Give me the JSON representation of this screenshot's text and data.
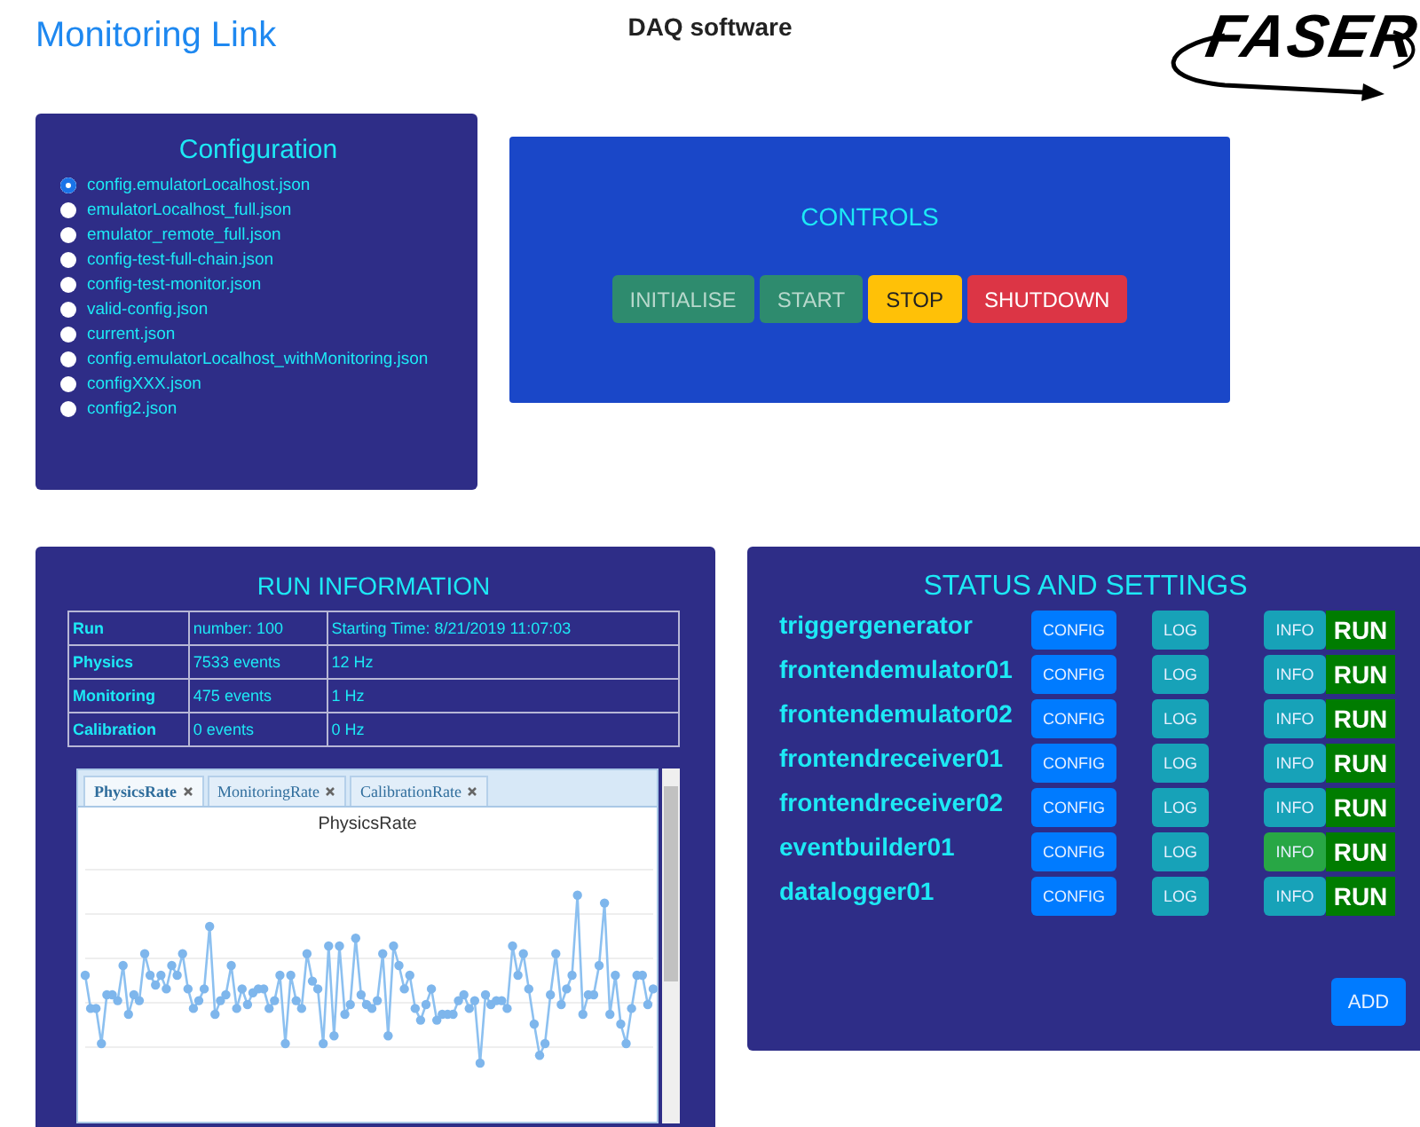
{
  "header": {
    "link": "Monitoring Link",
    "title": "DAQ software",
    "logo": "FASER"
  },
  "configuration": {
    "title": "Configuration",
    "files": [
      {
        "label": "config.emulatorLocalhost.json",
        "selected": true
      },
      {
        "label": "emulatorLocalhost_full.json",
        "selected": false
      },
      {
        "label": "emulator_remote_full.json",
        "selected": false
      },
      {
        "label": "config-test-full-chain.json",
        "selected": false
      },
      {
        "label": "config-test-monitor.json",
        "selected": false
      },
      {
        "label": "valid-config.json",
        "selected": false
      },
      {
        "label": "current.json",
        "selected": false
      },
      {
        "label": "config.emulatorLocalhost_withMonitoring.json",
        "selected": false
      },
      {
        "label": "configXXX.json",
        "selected": false
      },
      {
        "label": "config2.json",
        "selected": false
      }
    ]
  },
  "controls": {
    "title": "CONTROLS",
    "buttons": [
      {
        "label": "INITIALISE",
        "kind": "success",
        "disabled": true
      },
      {
        "label": "START",
        "kind": "success",
        "disabled": true
      },
      {
        "label": "STOP",
        "kind": "warning",
        "disabled": false
      },
      {
        "label": "SHUTDOWN",
        "kind": "danger",
        "disabled": false
      }
    ]
  },
  "run_information": {
    "title": "RUN INFORMATION",
    "rows": [
      [
        "Run",
        "number: 100",
        "Starting Time: 8/21/2019 11:07:03"
      ],
      [
        "Physics",
        "7533 events",
        "12 Hz"
      ],
      [
        "Monitoring",
        "475 events",
        "1 Hz"
      ],
      [
        "Calibration",
        "0 events",
        "0 Hz"
      ]
    ],
    "chart_tabs": [
      {
        "label": "PhysicsRate",
        "selected": true
      },
      {
        "label": "MonitoringRate",
        "selected": false
      },
      {
        "label": "CalibrationRate",
        "selected": false
      }
    ],
    "chart_title": "PhysicsRate"
  },
  "status": {
    "title": "STATUS AND SETTINGS",
    "components": [
      {
        "name": "triggergenerator",
        "config": "CONFIG",
        "log": "LOG",
        "info": "INFO",
        "info_active": false,
        "state": "RUN"
      },
      {
        "name": "frontendemulator01",
        "config": "CONFIG",
        "log": "LOG",
        "info": "INFO",
        "info_active": false,
        "state": "RUN"
      },
      {
        "name": "frontendemulator02",
        "config": "CONFIG",
        "log": "LOG",
        "info": "INFO",
        "info_active": false,
        "state": "RUN"
      },
      {
        "name": "frontendreceiver01",
        "config": "CONFIG",
        "log": "LOG",
        "info": "INFO",
        "info_active": false,
        "state": "RUN"
      },
      {
        "name": "frontendreceiver02",
        "config": "CONFIG",
        "log": "LOG",
        "info": "INFO",
        "info_active": false,
        "state": "RUN"
      },
      {
        "name": "eventbuilder01",
        "config": "CONFIG",
        "log": "LOG",
        "info": "INFO",
        "info_active": true,
        "state": "RUN"
      },
      {
        "name": "datalogger01",
        "config": "CONFIG",
        "log": "LOG",
        "info": "INFO",
        "info_active": false,
        "state": "RUN"
      }
    ],
    "add_button": "ADD"
  }
}
